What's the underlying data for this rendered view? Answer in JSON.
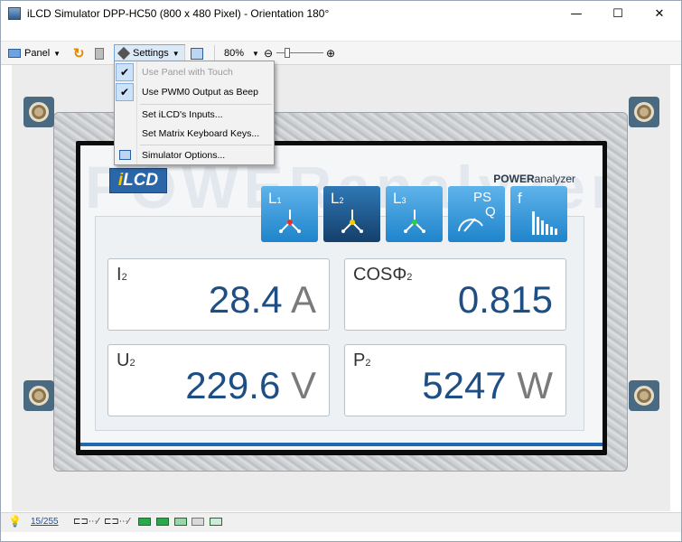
{
  "window": {
    "title": "iLCD Simulator DPP-HC50 (800 x 480 Pixel) - Orientation 180°",
    "minimize": "—",
    "maximize": "☐",
    "close": "✕"
  },
  "toolbar": {
    "panel_label": "Panel",
    "settings_label": "Settings",
    "zoom_value": "80%"
  },
  "settings_menu": {
    "items": [
      {
        "label": "Use Panel with Touch",
        "checked": true,
        "enabled": false
      },
      {
        "label": "Use PWM0 Output as Beep",
        "checked": true,
        "enabled": true
      },
      {
        "label": "Set iLCD's Inputs...",
        "checked": false,
        "enabled": true
      },
      {
        "label": "Set Matrix Keyboard Keys...",
        "checked": false,
        "enabled": true
      },
      {
        "label": "Simulator Options...",
        "checked": false,
        "enabled": true
      }
    ],
    "check_glyph": "✔"
  },
  "device_screen": {
    "background_word": "POWERanalyzer",
    "logo": {
      "i": "i",
      "rest": "LCD"
    },
    "brand_bold": "POWER",
    "brand_rest": "analyzer",
    "mode_buttons": [
      {
        "label": "L",
        "sub": "1"
      },
      {
        "label": "L",
        "sub": "2"
      },
      {
        "label": "L",
        "sub": "3"
      },
      {
        "label": "PS",
        "sub": "Q"
      },
      {
        "label": "f",
        "sub": ""
      }
    ],
    "readings": [
      {
        "label": "I",
        "sub": "2",
        "value": "28.4",
        "unit": "A"
      },
      {
        "label": "COSΦ",
        "sub": "2",
        "value": "0.815",
        "unit": ""
      },
      {
        "label": "U",
        "sub": "2",
        "value": "229.6",
        "unit": "V"
      },
      {
        "label": "P",
        "sub": "2",
        "value": "5247",
        "unit": "W"
      }
    ]
  },
  "statusbar": {
    "counter": "15/255"
  },
  "colors": {
    "accent_blue": "#1f84cb",
    "value_blue": "#1d4f84",
    "active_button": "#153f6b"
  }
}
